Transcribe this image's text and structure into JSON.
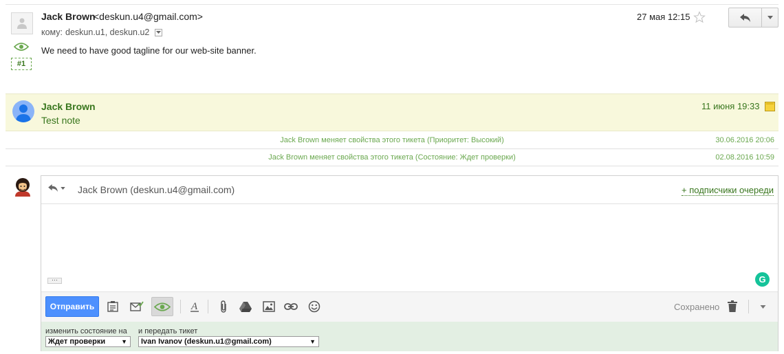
{
  "message": {
    "sender_name": "Jack Brown",
    "sender_email": "<deskun.u4@gmail.com>",
    "to_label": "кому:",
    "to_recipients": "deskun.u1, deskun.u2",
    "body": "We need to have good tagline for our web-site banner.",
    "ticket_number": "#1",
    "date": "27 мая 12:15"
  },
  "note": {
    "author": "Jack Brown",
    "text": "Test note",
    "date": "11 июня 19:33"
  },
  "history": [
    {
      "text": "Jack Brown меняет свойства этого тикета (Приоритет: Высокий)",
      "date": "30.06.2016 20:06"
    },
    {
      "text": "Jack Brown меняет свойства этого тикета (Состояние: Ждет проверки)",
      "date": "02.08.2016 10:59"
    }
  ],
  "composer": {
    "from": "Jack Brown (deskun.u4@gmail.com)",
    "subscribers_link": "+ подписчики очереди",
    "ellipsis": "···",
    "send_label": "Отправить",
    "saved_label": "Сохранено",
    "grammarly_letter": "G"
  },
  "status": {
    "state_label": "изменить состояние на",
    "state_value": "Ждет проверки",
    "assign_label": "и передать тикет",
    "assign_value": "Ivan Ivanov (deskun.u1@gmail.com)"
  }
}
